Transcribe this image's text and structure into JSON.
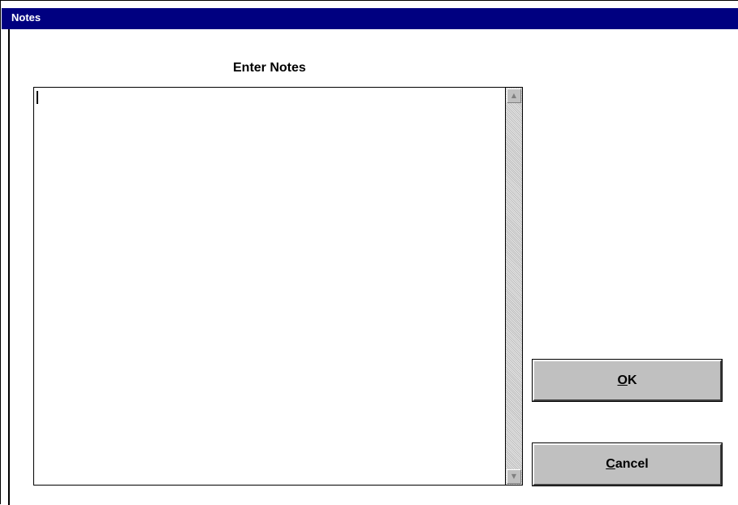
{
  "window": {
    "title": "Notes"
  },
  "main": {
    "heading": "Enter Notes",
    "notes_value": ""
  },
  "buttons": {
    "ok": {
      "mnemonic": "O",
      "rest": "K"
    },
    "cancel": {
      "mnemonic": "C",
      "rest": "ancel"
    }
  },
  "icons": {
    "scroll_up": "scroll-up-arrow-icon",
    "scroll_down": "scroll-down-arrow-icon"
  },
  "colors": {
    "titlebar": "#000080",
    "button_face": "#c0c0c0",
    "background": "#ffffff"
  }
}
